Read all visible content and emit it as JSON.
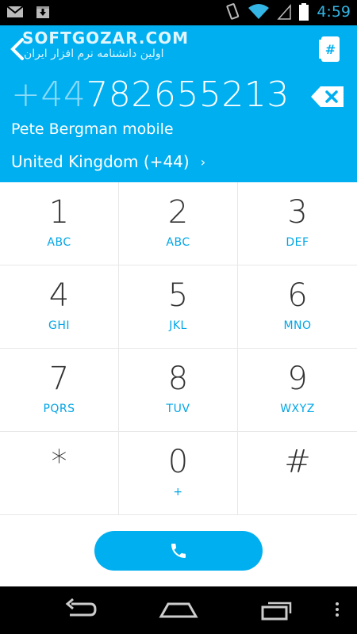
{
  "status_bar": {
    "time": "4:59",
    "icons": [
      "gmail-icon",
      "download-icon",
      "vibrate-icon",
      "wifi-icon",
      "signal-icon",
      "battery-icon"
    ]
  },
  "header": {
    "watermark_line1": "SOFTGOZAR.COM",
    "watermark_line2": "اولین دانشنامه نرم افزار ایران",
    "number_country_code": "+44",
    "number_rest": "782655213",
    "contact": "Pete Bergman mobile",
    "country": "United Kingdom (+44)",
    "country_chevron": "›",
    "back_icon": "back-chevron-icon",
    "dialpad_icon": "dialpad-contact-icon",
    "backspace_icon": "backspace-icon"
  },
  "keypad": [
    {
      "digit": "1",
      "letters": "ABC"
    },
    {
      "digit": "2",
      "letters": "ABC"
    },
    {
      "digit": "3",
      "letters": "DEF"
    },
    {
      "digit": "4",
      "letters": "GHI"
    },
    {
      "digit": "5",
      "letters": "JKL"
    },
    {
      "digit": "6",
      "letters": "MNO"
    },
    {
      "digit": "7",
      "letters": "PQRS"
    },
    {
      "digit": "8",
      "letters": "TUV"
    },
    {
      "digit": "9",
      "letters": "WXYZ"
    },
    {
      "digit": "*",
      "letters": ""
    },
    {
      "digit": "0",
      "letters": "+"
    },
    {
      "digit": "#",
      "letters": ""
    }
  ],
  "call_button": {
    "icon": "phone-icon"
  },
  "nav_bar": {
    "icons": [
      "back-icon",
      "home-icon",
      "recents-icon",
      "overflow-menu-icon"
    ]
  },
  "colors": {
    "accent": "#00aff0",
    "accent_text": "#00a5e6",
    "digit": "#333333",
    "status_time": "#33b5e5"
  }
}
